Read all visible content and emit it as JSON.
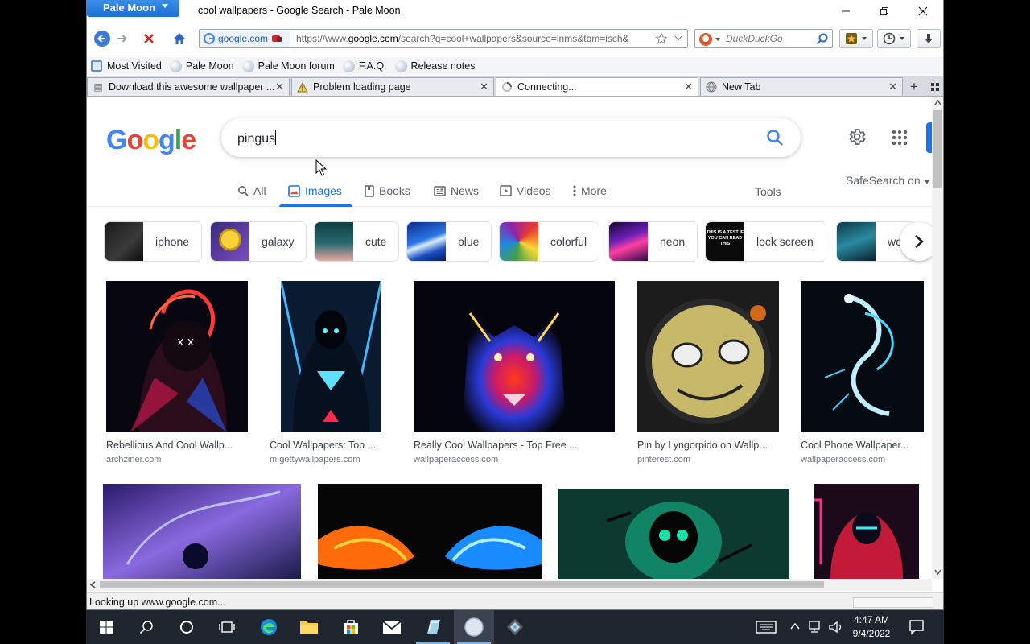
{
  "window": {
    "app_menu": "Pale Moon",
    "title": "cool wallpapers - Google Search - Pale Moon"
  },
  "navbar": {
    "identity_domain": "google.com",
    "url_prefix": "https://www.",
    "url_host": "google.com",
    "url_rest": "/search?q=cool+wallpapers&source=lnms&tbm=isch&",
    "search_placeholder": "DuckDuckGo"
  },
  "bookmarks": [
    {
      "label": "Most Visited"
    },
    {
      "label": "Pale Moon"
    },
    {
      "label": "Pale Moon forum"
    },
    {
      "label": "F.A.Q."
    },
    {
      "label": "Release notes"
    }
  ],
  "tabs": [
    {
      "label": "Download this awesome wallpaper ..."
    },
    {
      "label": "Problem loading page"
    },
    {
      "label": "Connecting..."
    },
    {
      "label": "New Tab"
    }
  ],
  "google": {
    "logo": {
      "g1": "G",
      "o1": "o",
      "o2": "o",
      "g2": "g",
      "l": "l",
      "e": "e"
    },
    "query": "pingus",
    "tabs": {
      "all": "All",
      "images": "Images",
      "books": "Books",
      "news": "News",
      "videos": "Videos",
      "more": "More",
      "tools": "Tools"
    },
    "safesearch": "SafeSearch on",
    "chips": [
      {
        "label": "iphone"
      },
      {
        "label": "galaxy"
      },
      {
        "label": "cute"
      },
      {
        "label": "blue"
      },
      {
        "label": "colorful"
      },
      {
        "label": "neon"
      },
      {
        "label": "lock screen"
      },
      {
        "label": "wo"
      }
    ],
    "chip_thumb_text": "THIS IS A TEST IF YOU CAN READ THIS",
    "results": [
      {
        "caption": "Rebellious And Cool Wallp...",
        "source": "archziner.com"
      },
      {
        "caption": "Cool Wallpapers: Top ...",
        "source": "m.gettywallpapers.com"
      },
      {
        "caption": "Really Cool Wallpapers - Top Free ...",
        "source": "wallpaperaccess.com"
      },
      {
        "caption": "Pin by Lyngorpido on Wallp...",
        "source": "pinterest.com"
      },
      {
        "caption": "Cool Phone Wallpaper...",
        "source": "wallpaperaccess.com"
      }
    ]
  },
  "status": "Looking up www.google.com...",
  "taskbar": {
    "time": "4:47 AM",
    "date": "9/4/2022"
  }
}
